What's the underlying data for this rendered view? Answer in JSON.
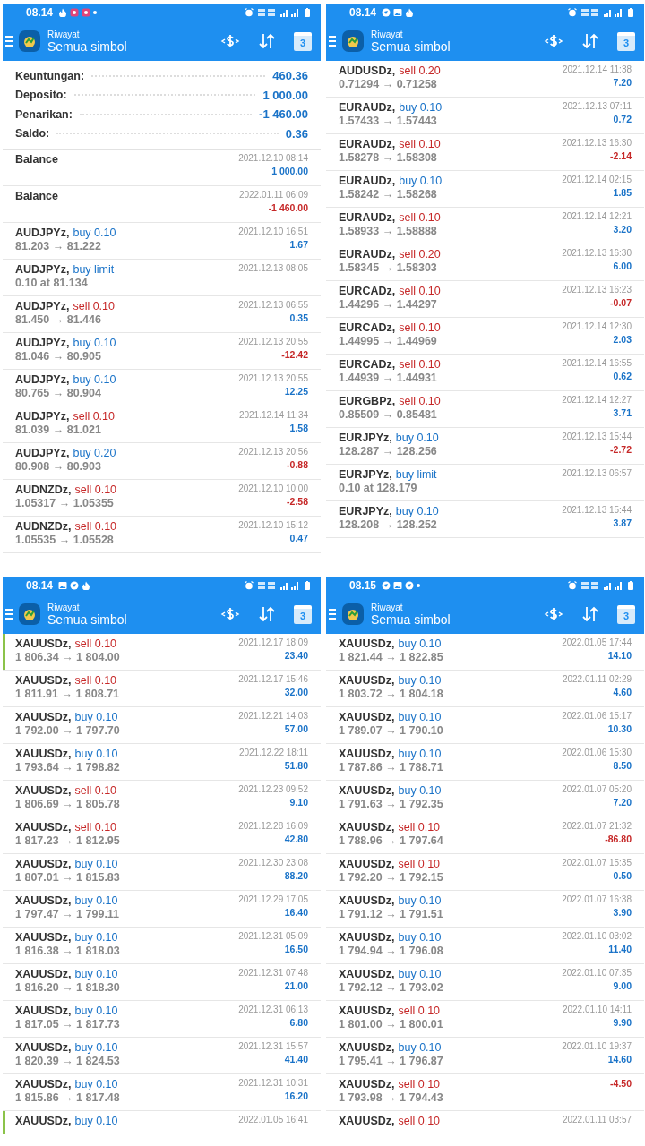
{
  "screens": [
    {
      "status_time": "08.14",
      "notifications": [
        {
          "kind": "flame"
        },
        {
          "kind": "badge"
        },
        {
          "kind": "badge"
        },
        {
          "kind": "dot"
        }
      ],
      "subtitle": "Riwayat",
      "title": "Semua simbol",
      "calendar_day": "3",
      "summary": [
        {
          "label": "Keuntungan:",
          "value": "460.36"
        },
        {
          "label": "Deposito:",
          "value": "1 000.00"
        },
        {
          "label": "Penarikan:",
          "value": "-1 460.00"
        },
        {
          "label": "Saldo:",
          "value": "0.36"
        }
      ],
      "rows": [
        {
          "kind": "balance",
          "symbol": "Balance",
          "time": "2021.12.10 08:14",
          "profit": "1 000.00",
          "negative": false,
          "marked": false
        },
        {
          "kind": "balance",
          "symbol": "Balance",
          "time": "2022.01.11 06:09",
          "profit": "-1 460.00",
          "negative": true,
          "marked": false
        },
        {
          "kind": "trade",
          "symbol": "AUDJPYz,",
          "sell": false,
          "action": "buy 0.10",
          "prices": "81.203 → 81.222",
          "time": "2021.12.10 16:51",
          "profit": "1.67",
          "negative": false,
          "marked": false
        },
        {
          "kind": "trade",
          "symbol": "AUDJPYz,",
          "sell": false,
          "action": "buy limit",
          "prices": "0.10 at 81.134",
          "time": "2021.12.13 08:05",
          "marked": false
        },
        {
          "kind": "trade",
          "symbol": "AUDJPYz,",
          "sell": true,
          "action": "sell 0.10",
          "prices": "81.450 → 81.446",
          "time": "2021.12.13 06:55",
          "profit": "0.35",
          "negative": false,
          "marked": false
        },
        {
          "kind": "trade",
          "symbol": "AUDJPYz,",
          "sell": false,
          "action": "buy 0.10",
          "prices": "81.046 → 80.905",
          "time": "2021.12.13 20:55",
          "profit": "-12.42",
          "negative": true,
          "marked": false
        },
        {
          "kind": "trade",
          "symbol": "AUDJPYz,",
          "sell": false,
          "action": "buy 0.10",
          "prices": "80.765 → 80.904",
          "time": "2021.12.13 20:55",
          "profit": "12.25",
          "negative": false,
          "marked": false
        },
        {
          "kind": "trade",
          "symbol": "AUDJPYz,",
          "sell": true,
          "action": "sell 0.10",
          "prices": "81.039 → 81.021",
          "time": "2021.12.14 11:34",
          "profit": "1.58",
          "negative": false,
          "marked": false
        },
        {
          "kind": "trade",
          "symbol": "AUDJPYz,",
          "sell": false,
          "action": "buy 0.20",
          "prices": "80.908 → 80.903",
          "time": "2021.12.13 20:56",
          "profit": "-0.88",
          "negative": true,
          "marked": false
        },
        {
          "kind": "trade",
          "symbol": "AUDNZDz,",
          "sell": true,
          "action": "sell 0.10",
          "prices": "1.05317 → 1.05355",
          "time": "2021.12.10 10:00",
          "profit": "-2.58",
          "negative": true,
          "marked": false
        },
        {
          "kind": "trade",
          "symbol": "AUDNZDz,",
          "sell": true,
          "action": "sell 0.10",
          "prices": "1.05535 → 1.05528",
          "time": "2021.12.10 15:12",
          "profit": "0.47",
          "negative": false,
          "marked": false
        }
      ]
    },
    {
      "status_time": "08.14",
      "notifications": [
        {
          "kind": "circle"
        },
        {
          "kind": "image"
        },
        {
          "kind": "flame"
        }
      ],
      "subtitle": "Riwayat",
      "title": "Semua simbol",
      "calendar_day": "3",
      "rows": [
        {
          "kind": "trade",
          "symbol": "AUDUSDz,",
          "sell": true,
          "action": "sell 0.20",
          "prices": "0.71294 → 0.71258",
          "time": "2021.12.14 11:38",
          "profit": "7.20",
          "negative": false,
          "marked": false
        },
        {
          "kind": "trade",
          "symbol": "EURAUDz,",
          "sell": false,
          "action": "buy 0.10",
          "prices": "1.57433 → 1.57443",
          "time": "2021.12.13 07:11",
          "profit": "0.72",
          "negative": false,
          "marked": false
        },
        {
          "kind": "trade",
          "symbol": "EURAUDz,",
          "sell": true,
          "action": "sell 0.10",
          "prices": "1.58278 → 1.58308",
          "time": "2021.12.13 16:30",
          "profit": "-2.14",
          "negative": true,
          "marked": false
        },
        {
          "kind": "trade",
          "symbol": "EURAUDz,",
          "sell": false,
          "action": "buy 0.10",
          "prices": "1.58242 → 1.58268",
          "time": "2021.12.14 02:15",
          "profit": "1.85",
          "negative": false,
          "marked": false
        },
        {
          "kind": "trade",
          "symbol": "EURAUDz,",
          "sell": true,
          "action": "sell 0.10",
          "prices": "1.58933 → 1.58888",
          "time": "2021.12.14 12:21",
          "profit": "3.20",
          "negative": false,
          "marked": false
        },
        {
          "kind": "trade",
          "symbol": "EURAUDz,",
          "sell": true,
          "action": "sell 0.20",
          "prices": "1.58345 → 1.58303",
          "time": "2021.12.13 16:30",
          "profit": "6.00",
          "negative": false,
          "marked": false
        },
        {
          "kind": "trade",
          "symbol": "EURCADz,",
          "sell": true,
          "action": "sell 0.10",
          "prices": "1.44296 → 1.44297",
          "time": "2021.12.13 16:23",
          "profit": "-0.07",
          "negative": true,
          "marked": false
        },
        {
          "kind": "trade",
          "symbol": "EURCADz,",
          "sell": true,
          "action": "sell 0.10",
          "prices": "1.44995 → 1.44969",
          "time": "2021.12.14 12:30",
          "profit": "2.03",
          "negative": false,
          "marked": false
        },
        {
          "kind": "trade",
          "symbol": "EURCADz,",
          "sell": true,
          "action": "sell 0.10",
          "prices": "1.44939 → 1.44931",
          "time": "2021.12.14 16:55",
          "profit": "0.62",
          "negative": false,
          "marked": false
        },
        {
          "kind": "trade",
          "symbol": "EURGBPz,",
          "sell": true,
          "action": "sell 0.10",
          "prices": "0.85509 → 0.85481",
          "time": "2021.12.14 12:27",
          "profit": "3.71",
          "negative": false,
          "marked": false
        },
        {
          "kind": "trade",
          "symbol": "EURJPYz,",
          "sell": false,
          "action": "buy 0.10",
          "prices": "128.287 → 128.256",
          "time": "2021.12.13 15:44",
          "profit": "-2.72",
          "negative": true,
          "marked": false
        },
        {
          "kind": "trade",
          "symbol": "EURJPYz,",
          "sell": false,
          "action": "buy limit",
          "prices": "0.10 at 128.179",
          "time": "2021.12.13 06:57",
          "marked": false
        },
        {
          "kind": "trade",
          "symbol": "EURJPYz,",
          "sell": false,
          "action": "buy 0.10",
          "prices": "128.208 → 128.252",
          "time": "2021.12.13 15:44",
          "profit": "3.87",
          "negative": false,
          "marked": false
        }
      ]
    },
    {
      "status_time": "08.14",
      "notifications": [
        {
          "kind": "image"
        },
        {
          "kind": "circle"
        },
        {
          "kind": "flame"
        }
      ],
      "subtitle": "Riwayat",
      "title": "Semua simbol",
      "calendar_day": "3",
      "rows": [
        {
          "kind": "trade",
          "symbol": "XAUUSDz,",
          "sell": true,
          "action": "sell 0.10",
          "prices": "1 806.34 → 1 804.00",
          "time": "2021.12.17 18:09",
          "profit": "23.40",
          "negative": false,
          "marked": true
        },
        {
          "kind": "trade",
          "symbol": "XAUUSDz,",
          "sell": true,
          "action": "sell 0.10",
          "prices": "1 811.91 → 1 808.71",
          "time": "2021.12.17 15:46",
          "profit": "32.00",
          "negative": false,
          "marked": false
        },
        {
          "kind": "trade",
          "symbol": "XAUUSDz,",
          "sell": false,
          "action": "buy 0.10",
          "prices": "1 792.00 → 1 797.70",
          "time": "2021.12.21 14:03",
          "profit": "57.00",
          "negative": false,
          "marked": false
        },
        {
          "kind": "trade",
          "symbol": "XAUUSDz,",
          "sell": false,
          "action": "buy 0.10",
          "prices": "1 793.64 → 1 798.82",
          "time": "2021.12.22 18:11",
          "profit": "51.80",
          "negative": false,
          "marked": false
        },
        {
          "kind": "trade",
          "symbol": "XAUUSDz,",
          "sell": true,
          "action": "sell 0.10",
          "prices": "1 806.69 → 1 805.78",
          "time": "2021.12.23 09:52",
          "profit": "9.10",
          "negative": false,
          "marked": false
        },
        {
          "kind": "trade",
          "symbol": "XAUUSDz,",
          "sell": true,
          "action": "sell 0.10",
          "prices": "1 817.23 → 1 812.95",
          "time": "2021.12.28 16:09",
          "profit": "42.80",
          "negative": false,
          "marked": false
        },
        {
          "kind": "trade",
          "symbol": "XAUUSDz,",
          "sell": false,
          "action": "buy 0.10",
          "prices": "1 807.01 → 1 815.83",
          "time": "2021.12.30 23:08",
          "profit": "88.20",
          "negative": false,
          "marked": false
        },
        {
          "kind": "trade",
          "symbol": "XAUUSDz,",
          "sell": false,
          "action": "buy 0.10",
          "prices": "1 797.47 → 1 799.11",
          "time": "2021.12.29 17:05",
          "profit": "16.40",
          "negative": false,
          "marked": false
        },
        {
          "kind": "trade",
          "symbol": "XAUUSDz,",
          "sell": false,
          "action": "buy 0.10",
          "prices": "1 816.38 → 1 818.03",
          "time": "2021.12.31 05:09",
          "profit": "16.50",
          "negative": false,
          "marked": false
        },
        {
          "kind": "trade",
          "symbol": "XAUUSDz,",
          "sell": false,
          "action": "buy 0.10",
          "prices": "1 816.20 → 1 818.30",
          "time": "2021.12.31 07:48",
          "profit": "21.00",
          "negative": false,
          "marked": false
        },
        {
          "kind": "trade",
          "symbol": "XAUUSDz,",
          "sell": false,
          "action": "buy 0.10",
          "prices": "1 817.05 → 1 817.73",
          "time": "2021.12.31 06:13",
          "profit": "6.80",
          "negative": false,
          "marked": false
        },
        {
          "kind": "trade",
          "symbol": "XAUUSDz,",
          "sell": false,
          "action": "buy 0.10",
          "prices": "1 820.39 → 1 824.53",
          "time": "2021.12.31 15:57",
          "profit": "41.40",
          "negative": false,
          "marked": false
        },
        {
          "kind": "trade",
          "symbol": "XAUUSDz,",
          "sell": false,
          "action": "buy 0.10",
          "prices": "1 815.86 → 1 817.48",
          "time": "2021.12.31 10:31",
          "profit": "16.20",
          "negative": false,
          "marked": false
        },
        {
          "kind": "trade",
          "symbol": "XAUUSDz,",
          "sell": false,
          "action": "buy 0.10",
          "time": "2022.01.05 16:41",
          "marked": true
        }
      ]
    },
    {
      "status_time": "08.15",
      "notifications": [
        {
          "kind": "circle"
        },
        {
          "kind": "image"
        },
        {
          "kind": "circle"
        },
        {
          "kind": "dot"
        }
      ],
      "subtitle": "Riwayat",
      "title": "Semua simbol",
      "calendar_day": "3",
      "rows": [
        {
          "kind": "trade",
          "symbol": "XAUUSDz,",
          "sell": false,
          "action": "buy 0.10",
          "prices": "1 821.44 → 1 822.85",
          "time": "2022.01.05 17:44",
          "profit": "14.10",
          "negative": false,
          "marked": false
        },
        {
          "kind": "trade",
          "symbol": "XAUUSDz,",
          "sell": false,
          "action": "buy 0.10",
          "prices": "1 803.72 → 1 804.18",
          "time": "2022.01.11 02:29",
          "profit": "4.60",
          "negative": false,
          "marked": false
        },
        {
          "kind": "trade",
          "symbol": "XAUUSDz,",
          "sell": false,
          "action": "buy 0.10",
          "prices": "1 789.07 → 1 790.10",
          "time": "2022.01.06 15:17",
          "profit": "10.30",
          "negative": false,
          "marked": false
        },
        {
          "kind": "trade",
          "symbol": "XAUUSDz,",
          "sell": false,
          "action": "buy 0.10",
          "prices": "1 787.86 → 1 788.71",
          "time": "2022.01.06 15:30",
          "profit": "8.50",
          "negative": false,
          "marked": false
        },
        {
          "kind": "trade",
          "symbol": "XAUUSDz,",
          "sell": false,
          "action": "buy 0.10",
          "prices": "1 791.63 → 1 792.35",
          "time": "2022.01.07 05:20",
          "profit": "7.20",
          "negative": false,
          "marked": false
        },
        {
          "kind": "trade",
          "symbol": "XAUUSDz,",
          "sell": true,
          "action": "sell 0.10",
          "prices": "1 788.96 → 1 797.64",
          "time": "2022.01.07 21:32",
          "profit": "-86.80",
          "negative": true,
          "marked": false
        },
        {
          "kind": "trade",
          "symbol": "XAUUSDz,",
          "sell": true,
          "action": "sell 0.10",
          "prices": "1 792.20 → 1 792.15",
          "time": "2022.01.07 15:35",
          "profit": "0.50",
          "negative": false,
          "marked": false
        },
        {
          "kind": "trade",
          "symbol": "XAUUSDz,",
          "sell": false,
          "action": "buy 0.10",
          "prices": "1 791.12 → 1 791.51",
          "time": "2022.01.07 16:38",
          "profit": "3.90",
          "negative": false,
          "marked": false
        },
        {
          "kind": "trade",
          "symbol": "XAUUSDz,",
          "sell": false,
          "action": "buy 0.10",
          "prices": "1 794.94 → 1 796.08",
          "time": "2022.01.10 03:02",
          "profit": "11.40",
          "negative": false,
          "marked": false
        },
        {
          "kind": "trade",
          "symbol": "XAUUSDz,",
          "sell": false,
          "action": "buy 0.10",
          "prices": "1 792.12 → 1 793.02",
          "time": "2022.01.10 07:35",
          "profit": "9.00",
          "negative": false,
          "marked": false
        },
        {
          "kind": "trade",
          "symbol": "XAUUSDz,",
          "sell": true,
          "action": "sell 0.10",
          "prices": "1 801.00 → 1 800.01",
          "time": "2022.01.10 14:11",
          "profit": "9.90",
          "negative": false,
          "marked": false
        },
        {
          "kind": "trade",
          "symbol": "XAUUSDz,",
          "sell": false,
          "action": "buy 0.10",
          "prices": "1 795.41 → 1 796.87",
          "time": "2022.01.10 19:37",
          "profit": "14.60",
          "negative": false,
          "marked": false
        },
        {
          "kind": "trade",
          "symbol": "XAUUSDz,",
          "sell": true,
          "action": "sell 0.10",
          "prices": "1 793.98 → 1 794.43",
          "profit": "-4.50",
          "negative": true,
          "marked": false
        },
        {
          "kind": "trade",
          "symbol": "XAUUSDz,",
          "sell": true,
          "action": "sell 0.10",
          "time": "2022.01.11 03:57",
          "marked": false
        }
      ]
    }
  ]
}
